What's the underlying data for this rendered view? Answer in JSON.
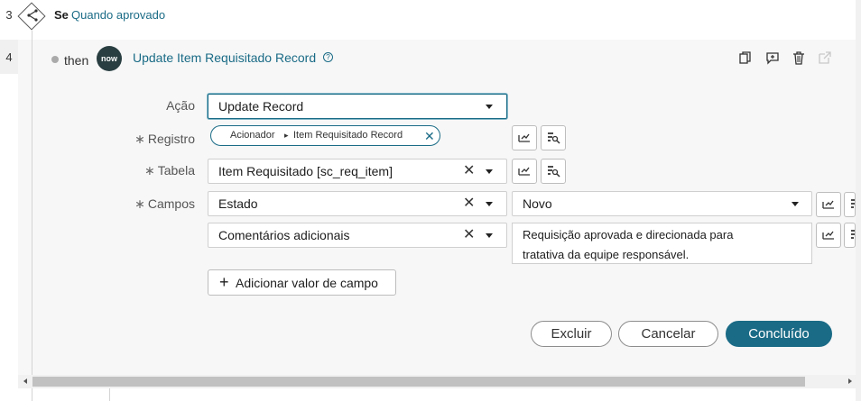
{
  "rows": {
    "row3": {
      "number": "3",
      "prefix": "Se",
      "condition": "Quando aprovado"
    },
    "row4": {
      "number": "4",
      "then": "then",
      "badge": "now",
      "title": "Update Item Requisitado Record",
      "help": "?"
    }
  },
  "form": {
    "acao": {
      "label": "Ação",
      "value": "Update Record"
    },
    "registro": {
      "label": "Registro",
      "required": "∗",
      "pill_source": "Acionador",
      "pill_separator": "▸",
      "pill_target": "Item Requisitado Record"
    },
    "tabela": {
      "label": "Tabela",
      "required": "∗",
      "value": "Item Requisitado [sc_req_item]"
    },
    "campos": {
      "label": "Campos",
      "required": "∗",
      "rows": [
        {
          "field": "Estado",
          "value": "Novo"
        },
        {
          "field": "Comentários adicionais",
          "value_line1": "Requisição aprovada e direcionada para",
          "value_line2": "tratativa da equipe responsável."
        }
      ]
    },
    "add_field_label": "Adicionar valor de campo",
    "add_field_icon": "+"
  },
  "footer": {
    "delete": "Excluir",
    "cancel": "Cancelar",
    "done": "Concluído"
  },
  "colors": {
    "accent": "#1a6b86",
    "now_badge": "#293e40"
  },
  "icons": [
    "flow-decision-icon",
    "copy-icon",
    "comment-icon",
    "trash-icon",
    "open-external-icon",
    "data-pill-icon",
    "data-picker-icon"
  ]
}
